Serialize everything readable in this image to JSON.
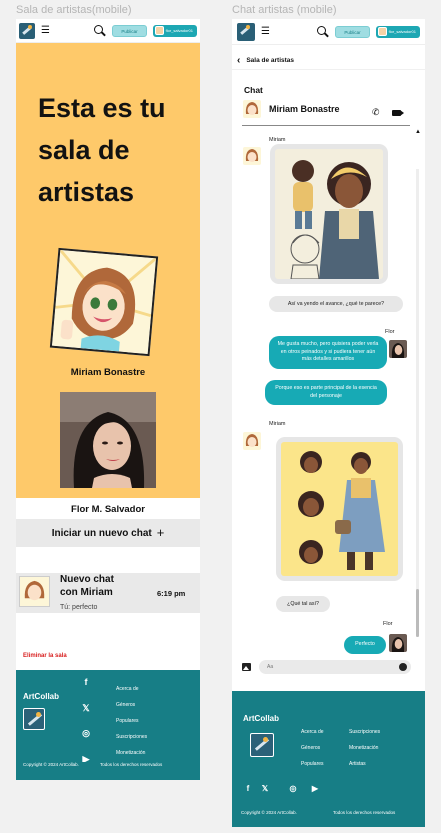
{
  "frames": {
    "left_title": "Sala de artistas(mobile)",
    "right_title": "Chat artistas (mobile)"
  },
  "header": {
    "publish_label": "Publicar",
    "username": "flor_salvador01"
  },
  "room": {
    "hero_title": "Esta es tu sala de artistas",
    "artist1_name": "Miriam Bonastre",
    "artist2_name": "Flor M. Salvador",
    "new_chat_label": "Iniciar un nuevo chat",
    "chat_preview": {
      "title": "Nuevo chat con Miriam",
      "time": "6:19 pm",
      "last_message": "Tú: perfecto"
    },
    "delete_label": "Eliminar la sala"
  },
  "chat": {
    "back_label": "Sala de artistas",
    "section_label": "Chat",
    "contact_name": "Miriam Bonastre",
    "messages": [
      {
        "sender": "Miriam",
        "text": "Así va yendo el avance, ¿qué te parece?"
      },
      {
        "sender": "Flor",
        "text": "Me gusta mucho, pero quisiera poder verla en otros peinados y si pudiera tener aún más detalles amarillos"
      },
      {
        "sender": "Flor",
        "text": "Porque eso es parte principal de la esencia del personaje"
      },
      {
        "sender": "Miriam",
        "text": "¿Qué tal así?"
      },
      {
        "sender": "Flor",
        "text": "Perfecto"
      }
    ],
    "input_placeholder": "Aa"
  },
  "footer": {
    "brand": "ArtCollab",
    "links": [
      "Acerca de",
      "Géneros",
      "Populares",
      "Suscripciones",
      "Monetización",
      "Artistas"
    ],
    "social": [
      "facebook",
      "x",
      "instagram",
      "youtube"
    ],
    "copyright": "Copyright © 2024 ArtCollab.",
    "rights": "Todos los derechos reservados"
  },
  "colors": {
    "teal": "#177e86",
    "accent": "#17aab5",
    "hero": "#fec96a",
    "danger": "#d81e1e"
  }
}
